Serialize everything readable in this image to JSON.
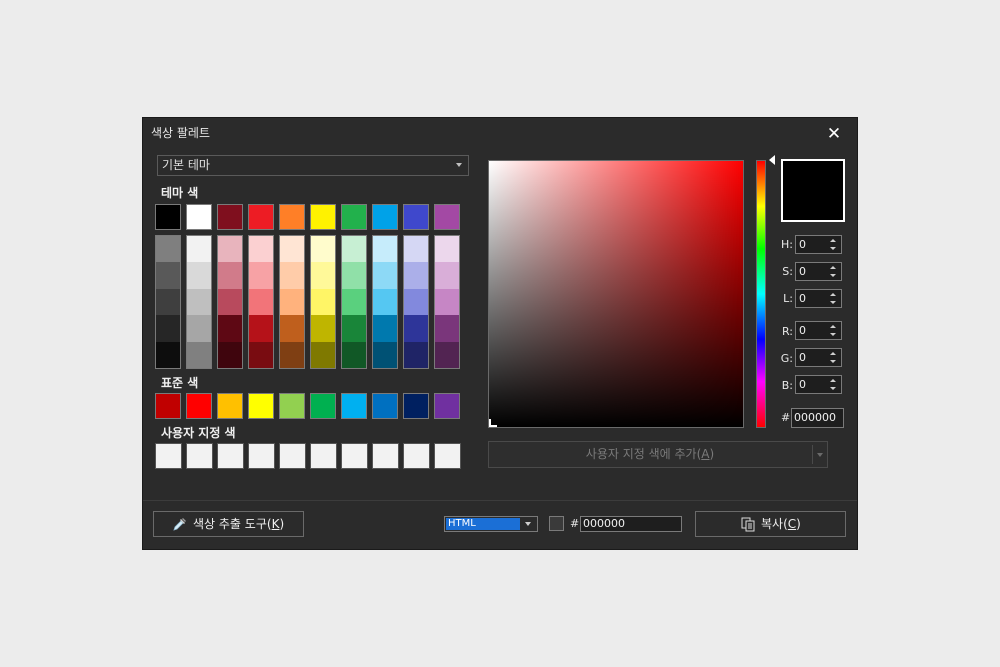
{
  "dialog": {
    "title": "색상 팔레트",
    "close_glyph": "✕"
  },
  "theme_dropdown": {
    "value": "기본 테마"
  },
  "labels": {
    "theme_colors": "테마 색",
    "standard_colors": "표준 색",
    "custom_colors": "사용자 지정 색"
  },
  "theme_top_colors": [
    "#000000",
    "#ffffff",
    "#7f0f1e",
    "#ed1c24",
    "#ff7f27",
    "#fff200",
    "#22b14c",
    "#00a2e8",
    "#3f48cc",
    "#a349a4"
  ],
  "theme_shades": [
    [
      "#7f7f7f",
      "#595959",
      "#3f3f3f",
      "#262626",
      "#0d0d0d"
    ],
    [
      "#f2f2f2",
      "#d9d9d9",
      "#bfbfbf",
      "#a6a6a6",
      "#808080"
    ],
    [
      "#e8b4bd",
      "#d17b8a",
      "#b84a5d",
      "#5e0814",
      "#3f050d"
    ],
    [
      "#fbd0d1",
      "#f7a2a5",
      "#f27479",
      "#b51219",
      "#790c11"
    ],
    [
      "#ffe5d4",
      "#ffcca9",
      "#ffb27d",
      "#bf5f1d",
      "#7f3f13"
    ],
    [
      "#fffccc",
      "#fff999",
      "#fff566",
      "#bfb500",
      "#7f7900"
    ],
    [
      "#c7efd3",
      "#90e0a8",
      "#5ad07e",
      "#198539",
      "#115826"
    ],
    [
      "#c6ecfb",
      "#8dd9f6",
      "#55c7f2",
      "#0079ae",
      "#005174"
    ],
    [
      "#d5d7f4",
      "#abafe9",
      "#8289dd",
      "#2e3599",
      "#1f2466"
    ],
    [
      "#ecd7ec",
      "#d9aed8",
      "#c686c5",
      "#7a367b",
      "#522452"
    ]
  ],
  "standard_colors": [
    "#c00000",
    "#ff0000",
    "#ffc000",
    "#ffff00",
    "#92d050",
    "#00b050",
    "#00b0f0",
    "#0070c0",
    "#002060",
    "#7030a0"
  ],
  "custom_colors": [
    "#f2f2f2",
    "#f2f2f2",
    "#f2f2f2",
    "#f2f2f2",
    "#f2f2f2",
    "#f2f2f2",
    "#f2f2f2",
    "#f2f2f2",
    "#f2f2f2",
    "#f2f2f2"
  ],
  "fields": {
    "h": {
      "label": "H:",
      "value": "0"
    },
    "s": {
      "label": "S:",
      "value": "0"
    },
    "l": {
      "label": "L:",
      "value": "0"
    },
    "r": {
      "label": "R:",
      "value": "0"
    },
    "g": {
      "label": "G:",
      "value": "0"
    },
    "b": {
      "label": "B:",
      "value": "0"
    }
  },
  "hex": {
    "hash": "#",
    "value": "000000"
  },
  "add_custom": {
    "label_prefix": "사용자 지정 색에 추가(",
    "mnemonic": "A",
    "label_suffix": ")"
  },
  "eyedropper": {
    "label_prefix": "색상 추출 도구(",
    "mnemonic": "K",
    "label_suffix": ")"
  },
  "format": {
    "value": "HTML"
  },
  "output": {
    "hash": "#",
    "value": "000000"
  },
  "copy": {
    "label_prefix": "복사(",
    "mnemonic": "C",
    "label_suffix": ")"
  },
  "current_color": "#000000",
  "icons": {
    "close": "close-icon",
    "eyedropper": "eyedropper-icon",
    "copy": "copy-icon"
  }
}
